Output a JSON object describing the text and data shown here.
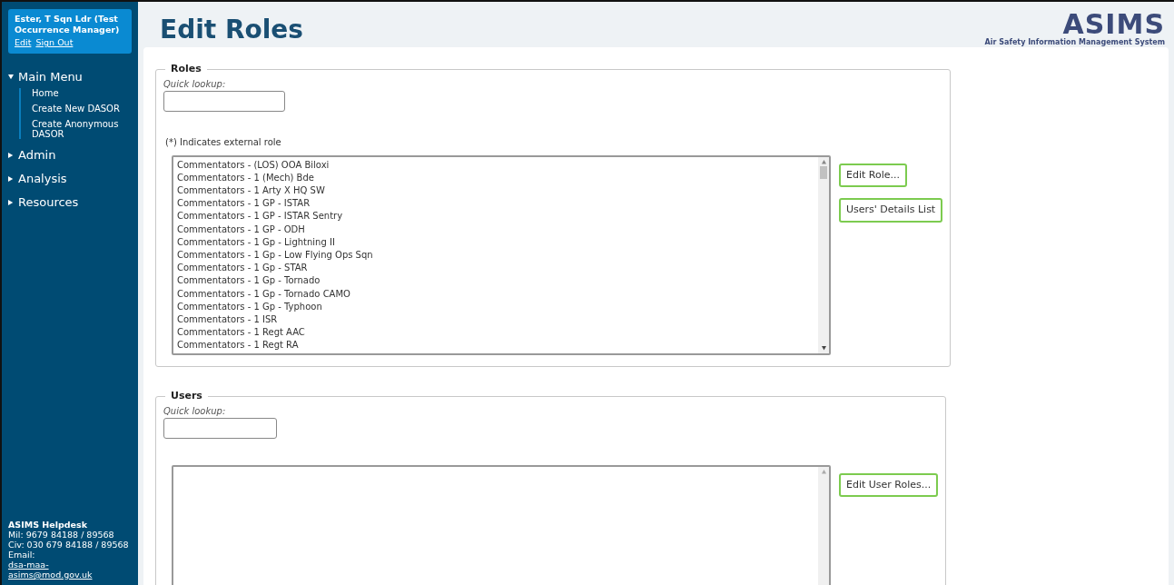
{
  "user_panel": {
    "name": "Ester, T Sqn Ldr (Test Occurrence Manager)",
    "links": [
      "Edit",
      "Sign Out"
    ]
  },
  "menu": [
    {
      "label": "Main Menu",
      "expanded": true,
      "children": [
        {
          "label": "Home"
        },
        {
          "label": "Create New DASOR"
        },
        {
          "label": "Create Anonymous DASOR"
        }
      ]
    },
    {
      "label": "Admin",
      "expanded": false
    },
    {
      "label": "Analysis",
      "expanded": false
    },
    {
      "label": "Resources",
      "expanded": false
    }
  ],
  "helpdesk": {
    "title": "ASIMS Helpdesk",
    "lines": [
      "Mil: 9679 84188 / 89568",
      "Civ: 030 679 84188 / 89568"
    ],
    "email_label": "Email:",
    "email": "dsa-maa-asims@mod.gov.uk"
  },
  "page_title": "Edit Roles",
  "logo": {
    "name": "ASIMS",
    "tagline": "Air Safety Information Management System"
  },
  "roles": {
    "legend": "Roles",
    "lookup_label": "Quick lookup:",
    "note": "(*) Indicates external role",
    "items": [
      "Commentators - (LOS) OOA Biloxi",
      "Commentators - 1 (Mech) Bde",
      "Commentators - 1 Arty X HQ SW",
      "Commentators - 1 GP - ISTAR",
      "Commentators - 1 GP - ISTAR Sentry",
      "Commentators - 1 GP - ODH",
      "Commentators - 1 Gp - Lightning II",
      "Commentators - 1 Gp - Low Flying Ops Sqn",
      "Commentators - 1 Gp - STAR",
      "Commentators - 1 Gp - Tornado",
      "Commentators - 1 Gp - Tornado CAMO",
      "Commentators - 1 Gp - Typhoon",
      "Commentators - 1 ISR",
      "Commentators - 1 Regt AAC",
      "Commentators - 1 Regt RA"
    ],
    "buttons": [
      "Edit Role...",
      "Users' Details List"
    ]
  },
  "users": {
    "legend": "Users",
    "lookup_label": "Quick lookup:",
    "buttons": [
      "Edit User Roles..."
    ]
  }
}
